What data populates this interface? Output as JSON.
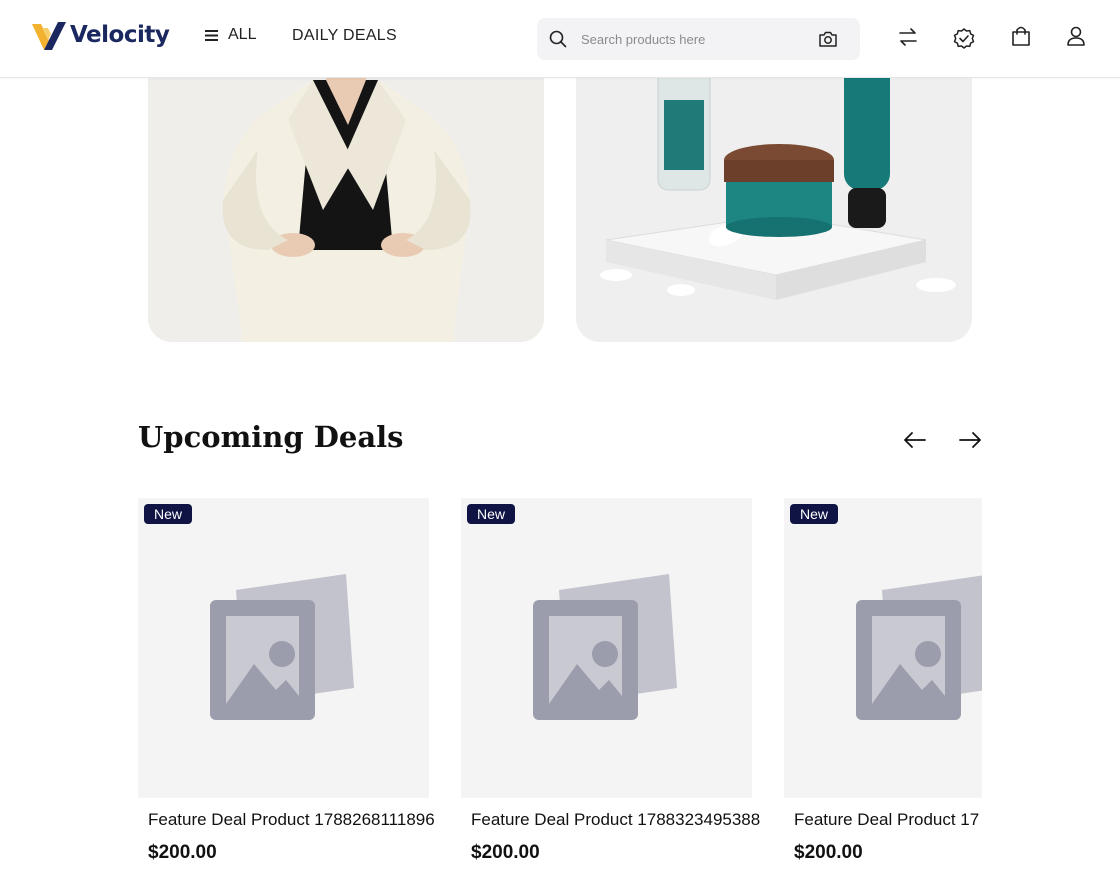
{
  "brand": {
    "name": "Velocity",
    "accent": "#1b2860",
    "logo_gold": "#f2b230"
  },
  "nav": {
    "all_label": "ALL",
    "deals_label": "DAILY DEALS"
  },
  "search": {
    "placeholder": "Search products here"
  },
  "header_icons": [
    "compare-icon",
    "verified-badge-icon",
    "shopping-bag-icon",
    "user-icon"
  ],
  "section": {
    "title": "Upcoming Deals"
  },
  "cards": [
    {
      "badge": "New",
      "name": "Feature Deal Product 1788268111896",
      "price": "$200.00"
    },
    {
      "badge": "New",
      "name": "Feature Deal Product 1788323495388",
      "price": "$200.00"
    },
    {
      "badge": "New",
      "name": "Feature Deal Product 17",
      "price": "$200.00"
    }
  ]
}
